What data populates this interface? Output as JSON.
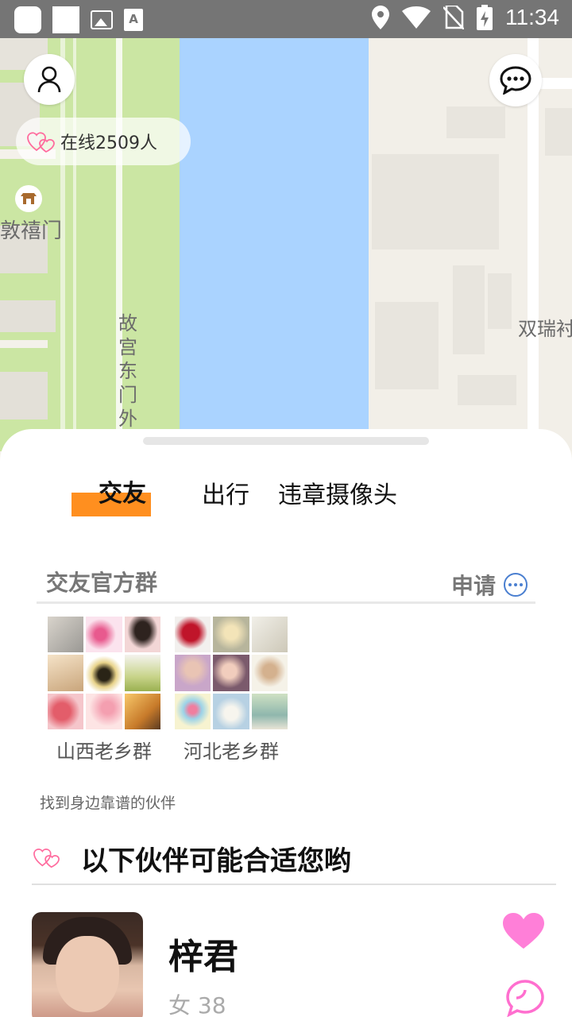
{
  "status_bar": {
    "time": "11:34"
  },
  "map": {
    "online_label": "在线2509人",
    "labels": {
      "gate": "敦禧门",
      "east_gate": "故宫东门外",
      "shuangrui": "双瑞衬"
    }
  },
  "sheet": {
    "tabs": [
      {
        "label": "交友",
        "active": true
      },
      {
        "label": "出行",
        "active": false
      },
      {
        "label": "违章摄像头",
        "active": false
      }
    ],
    "official_group": {
      "title": "交友官方群",
      "apply_label": "申请"
    },
    "groups": [
      {
        "name": "山西老乡群"
      },
      {
        "name": "河北老乡群"
      }
    ],
    "find_text": "找到身边靠谱的伙伴",
    "suggest_title": "以下伙伴可能合适您哟",
    "person": {
      "name": "梓君",
      "info": "女 38"
    }
  },
  "colors": {
    "tab_accent": "#ff8f1f",
    "like": "#ff7fd8",
    "river": "#aad3ff",
    "park": "#cbe6a3"
  }
}
